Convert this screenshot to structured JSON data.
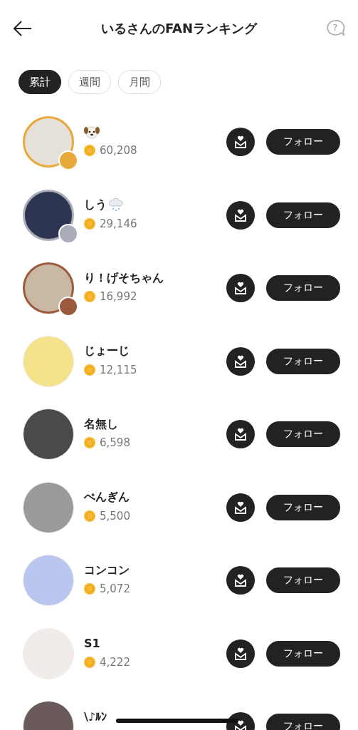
{
  "header": {
    "title": "いるさんのFANランキング",
    "help": "?"
  },
  "tabs": [
    {
      "label": "累計",
      "selected": true
    },
    {
      "label": "週間",
      "selected": false
    },
    {
      "label": "月間",
      "selected": false
    }
  ],
  "fans": [
    {
      "kind": "dog-emoji",
      "count": "60,208",
      "color": "#e8a93a",
      "follow": "フォロー"
    },
    {
      "name": "しう",
      "kind": "cloud-emoji",
      "count": "29,146",
      "color": "#a9adb8",
      "follow": "フォロー"
    },
    {
      "name": "り！げそちゃん",
      "count": "16,992",
      "color": "#9c5a3c",
      "follow": "フォロー"
    },
    {
      "name": "じょーじ",
      "count": "12,115",
      "follow": "フォロー"
    },
    {
      "name": "名無し",
      "count": "6,598",
      "follow": "フォロー"
    },
    {
      "name": "ぺんぎん",
      "count": "5,500",
      "follow": "フォロー"
    },
    {
      "name": "コンコン",
      "count": "5,072",
      "follow": "フォロー"
    },
    {
      "name": "S1",
      "count": "4,222",
      "follow": "フォロー"
    },
    {
      "name": "\\♪ﾙﾝ",
      "follow": "フォロー"
    }
  ]
}
